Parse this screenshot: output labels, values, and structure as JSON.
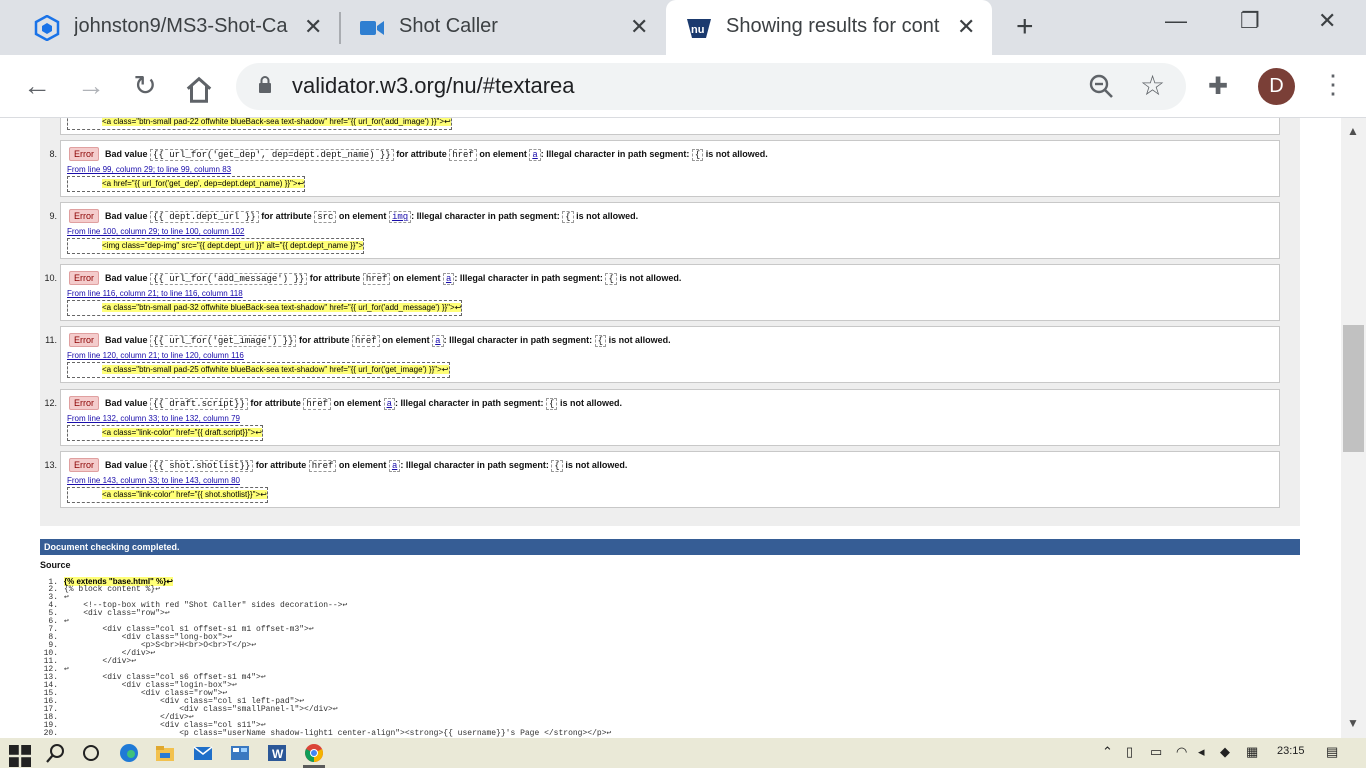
{
  "browser": {
    "tabs": [
      {
        "title": "johnston9/MS3-Shot-Ca",
        "icon": "cube-icon",
        "color": "#1a73e8"
      },
      {
        "title": "Shot Caller",
        "icon": "video-camera-icon",
        "color": "#2f7fd1"
      },
      {
        "title": "Showing results for cont",
        "icon": "w3c-validator-icon",
        "color": "#1b3a6e",
        "active": true
      }
    ],
    "new_tab": "+",
    "url": "validator.w3.org/nu/#textarea",
    "avatar_initial": "D"
  },
  "messages": [
    {
      "num": "",
      "extract": "<a class=\"btn-small pad-22 offwhite blueBack-sea text-shadow\" href=\"{{ url_for('add_image') }}\">↩"
    },
    {
      "num": "8.",
      "type": "Error",
      "bad_value": "{{ url_for('get_dep', dep=dept.dept_name) }}",
      "attribute": "href",
      "element": "a",
      "location": "From line 99, column 29; to line 99, column 83",
      "extract": "<a href=\"{{ url_for('get_dep', dep=dept.dept_name) }}\">↩"
    },
    {
      "num": "9.",
      "type": "Error",
      "bad_value": "{{ dept.dept_url }}",
      "attribute": "src",
      "element": "img",
      "location": "From line 100, column 29; to line 100, column 102",
      "extract": "<img class=\"dep-img\" src=\"{{ dept.dept_url }}\" alt=\"{{ dept.dept_name }}\">"
    },
    {
      "num": "10.",
      "type": "Error",
      "bad_value": "{{ url_for('add_message') }}",
      "attribute": "href",
      "element": "a",
      "location": "From line 116, column 21; to line 116, column 118",
      "extract": "<a class=\"btn-small pad-32 offwhite blueBack-sea text-shadow\" href=\"{{ url_for('add_message') }}\">↩"
    },
    {
      "num": "11.",
      "type": "Error",
      "bad_value": "{{ url_for('get_image') }}",
      "attribute": "href",
      "element": "a",
      "location": "From line 120, column 21; to line 120, column 116",
      "extract": "<a class=\"btn-small pad-25 offwhite blueBack-sea text-shadow\" href=\"{{ url_for('get_image') }}\">↩"
    },
    {
      "num": "12.",
      "type": "Error",
      "bad_value": "{{ draft.script}}",
      "attribute": "href",
      "element": "a",
      "location": "From line 132, column 33; to line 132, column 79",
      "extract": "<a class=\"link-color\" href=\"{{ draft.script}}\">↩"
    },
    {
      "num": "13.",
      "type": "Error",
      "bad_value": "{{ shot.shotlist}}",
      "attribute": "href",
      "element": "a",
      "location": "From line 143, column 33; to line 143, column 80",
      "extract": "<a class=\"link-color\" href=\"{{ shot.shotlist}}\">↩"
    }
  ],
  "labels": {
    "bad_value": "Bad value",
    "for_attribute": "for attribute",
    "on_element": "on element",
    "illegal": ": Illegal character in path segment:",
    "brace": "{",
    "not_allowed": "is not allowed."
  },
  "status": "Document checking completed.",
  "source_heading": "Source",
  "source_lines": [
    "{% extends \"base.html\" %}↩",
    "{% block content %}↩",
    "↩",
    "    <!--top-box with red \"Shot Caller\" sides decoration-->↩",
    "    <div class=\"row\">↩",
    "↩",
    "        <div class=\"col s1 offset-s1 m1 offset-m3\">↩",
    "            <div class=\"long-box\">↩",
    "                <p>S<br>H<br>O<br>T</p>↩",
    "            </div>↩",
    "        </div>↩",
    "↩",
    "        <div class=\"col s6 offset-s1 m4\">↩",
    "            <div class=\"login-box\">↩",
    "                <div class=\"row\">↩",
    "                    <div class=\"col s1 left-pad\">↩",
    "                        <div class=\"smallPanel-l\"></div>↩",
    "                    </div>↩",
    "                    <div class=\"col s11\">↩",
    "                        <p class=\"userName shadow-light1 center-align\"><strong>{{ username}}'s Page </strong></p>↩"
  ],
  "taskbar": {
    "clock": "23:15",
    "apps": [
      "windows-start-icon",
      "search-icon",
      "task-view-icon",
      "edge-icon",
      "file-explorer-icon",
      "mail-icon",
      "control-panel-icon",
      "word-icon",
      "chrome-icon"
    ]
  }
}
